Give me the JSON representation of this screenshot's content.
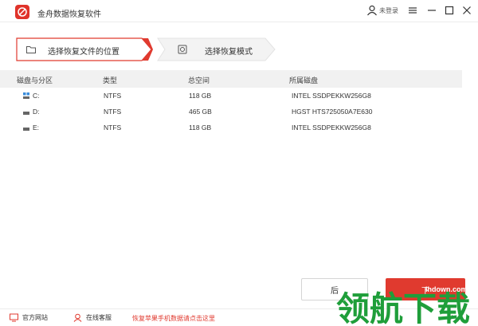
{
  "window": {
    "title": "金舟数据恢复软件",
    "user_label": "未登录"
  },
  "steps": [
    {
      "label": "选择恢复文件的位置",
      "active": true
    },
    {
      "label": "选择恢复模式",
      "active": false
    }
  ],
  "table": {
    "columns": [
      "磁盘与分区",
      "类型",
      "总空间",
      "所属磁盘"
    ],
    "rows": [
      {
        "name": "C:",
        "type": "NTFS",
        "size": "118 GB",
        "disk": "INTEL SSDPEKKW256G8",
        "icon": "system-drive-icon"
      },
      {
        "name": "D:",
        "type": "NTFS",
        "size": "465 GB",
        "disk": "HGST HTS725050A7E630",
        "icon": "drive-icon"
      },
      {
        "name": "E:",
        "type": "NTFS",
        "size": "118 GB",
        "disk": "INTEL SSDPEKKW256G8",
        "icon": "drive-icon"
      }
    ]
  },
  "buttons": {
    "prev": "后",
    "next": "下"
  },
  "footer": {
    "website": "官方网站",
    "support": "在线客服",
    "promo": "恢复苹果手机数据请点击这里",
    "version": "V-"
  },
  "watermark": {
    "text": "领航下载",
    "url": "lhdown.com"
  },
  "colors": {
    "accent": "#e03a2f",
    "header_bg": "#f1f1f1"
  }
}
